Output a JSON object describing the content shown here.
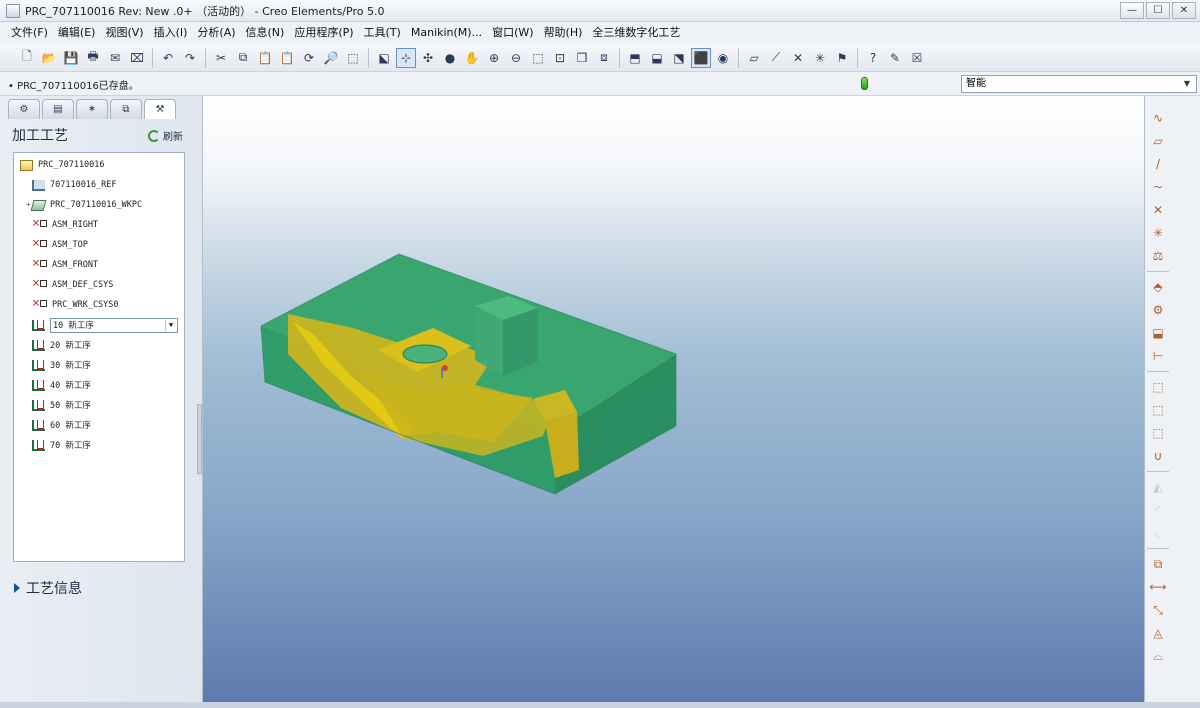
{
  "window": {
    "title": "PRC_707110016 Rev: New .0+  （活动的） - Creo Elements/Pro 5.0",
    "buttons": {
      "minimize": "—",
      "maximize": "☐",
      "close": "✕"
    }
  },
  "menu": [
    "文件(F)",
    "编辑(E)",
    "视图(V)",
    "插入(I)",
    "分析(A)",
    "信息(N)",
    "应用程序(P)",
    "工具(T)",
    "Manikin(M)...",
    "窗口(W)",
    "帮助(H)",
    "全三维数字化工艺"
  ],
  "toolbar": {
    "groups": [
      [
        {
          "icon": "new-file-icon",
          "glyph": "🗋"
        },
        {
          "icon": "open-folder-icon",
          "glyph": "📂"
        },
        {
          "icon": "save-icon",
          "glyph": "💾"
        },
        {
          "icon": "print-icon",
          "glyph": "🖶"
        },
        {
          "icon": "send-mail-icon",
          "glyph": "✉"
        },
        {
          "icon": "close-window-icon",
          "glyph": "⌧"
        }
      ],
      [
        {
          "icon": "undo-icon",
          "glyph": "↶"
        },
        {
          "icon": "redo-icon",
          "glyph": "↷"
        }
      ],
      [
        {
          "icon": "cut-icon",
          "glyph": "✂"
        },
        {
          "icon": "copy-icon",
          "glyph": "⧉"
        },
        {
          "icon": "paste-icon",
          "glyph": "📋"
        },
        {
          "icon": "paste-special-icon",
          "glyph": "📋"
        },
        {
          "icon": "regenerate-icon",
          "glyph": "⟳"
        },
        {
          "icon": "search-icon",
          "glyph": "🔎"
        },
        {
          "icon": "selection-icon",
          "glyph": "⬚"
        }
      ],
      [
        {
          "icon": "repaint-icon",
          "glyph": "⬕"
        },
        {
          "icon": "spin-center-icon",
          "glyph": "⊹",
          "active": true
        },
        {
          "icon": "orient-mode-icon",
          "glyph": "✣"
        },
        {
          "icon": "appearance-icon",
          "glyph": "●"
        },
        {
          "icon": "pan-icon",
          "glyph": "✋"
        },
        {
          "icon": "zoom-in-icon",
          "glyph": "⊕"
        },
        {
          "icon": "zoom-out-icon",
          "glyph": "⊖"
        },
        {
          "icon": "refit-icon",
          "glyph": "⬚"
        },
        {
          "icon": "reorient-icon",
          "glyph": "⊡"
        },
        {
          "icon": "saved-views-icon",
          "glyph": "❒"
        },
        {
          "icon": "layers-icon",
          "glyph": "⧈"
        }
      ],
      [
        {
          "icon": "wireframe-icon",
          "glyph": "⬒"
        },
        {
          "icon": "hidden-line-icon",
          "glyph": "⬓"
        },
        {
          "icon": "no-hidden-icon",
          "glyph": "⬔"
        },
        {
          "icon": "shading-icon",
          "glyph": "⬛",
          "active": true
        },
        {
          "icon": "model-tree-icon",
          "glyph": "◉"
        }
      ],
      [
        {
          "icon": "datum-planes-icon",
          "glyph": "▱"
        },
        {
          "icon": "datum-axes-icon",
          "glyph": "⟋"
        },
        {
          "icon": "datum-points-icon",
          "glyph": "✕"
        },
        {
          "icon": "coord-sys-icon",
          "glyph": "✳"
        },
        {
          "icon": "annotation-icon",
          "glyph": "⚑"
        }
      ],
      [
        {
          "icon": "context-help-icon",
          "glyph": "?"
        },
        {
          "icon": "markup-icon",
          "glyph": "✎"
        },
        {
          "icon": "exit-icon",
          "glyph": "☒"
        }
      ]
    ]
  },
  "message": "• PRC_707110016已存盘。",
  "filter": {
    "value": "智能",
    "arrow": "▼"
  },
  "left_panel": {
    "tabs": [
      {
        "icon": "model-tree-tab-icon",
        "glyph": "⚙"
      },
      {
        "icon": "folder-tab-icon",
        "glyph": "▤"
      },
      {
        "icon": "favorites-tab-icon",
        "glyph": "✶"
      },
      {
        "icon": "layers-tab-icon",
        "glyph": "⧉"
      },
      {
        "icon": "process-tab-icon",
        "glyph": "⚒",
        "active": true
      }
    ],
    "header": "加工工艺",
    "refresh_label": "刷新",
    "tree": [
      {
        "label": "PRC_707110016",
        "icon": "part",
        "indent": 0
      },
      {
        "label": "707110016_REF",
        "icon": "ref",
        "indent": 1
      },
      {
        "label": "PRC_707110016_WKPC",
        "icon": "wk",
        "indent": 1,
        "expand": "+"
      },
      {
        "label": "ASM_RIGHT",
        "icon": "datum",
        "indent": 1
      },
      {
        "label": "ASM_TOP",
        "icon": "datum",
        "indent": 1
      },
      {
        "label": "ASM_FRONT",
        "icon": "datum",
        "indent": 1
      },
      {
        "label": "ASM_DEF_CSYS",
        "icon": "datum",
        "indent": 1
      },
      {
        "label": "PRC_WRK_CSYS0",
        "icon": "datum",
        "indent": 1
      },
      {
        "label": "10 新工序",
        "icon": "op",
        "indent": 1,
        "editing": true
      },
      {
        "label": "20 新工序",
        "icon": "op",
        "indent": 1
      },
      {
        "label": "30 新工序",
        "icon": "op",
        "indent": 1
      },
      {
        "label": "40 新工序",
        "icon": "op",
        "indent": 1
      },
      {
        "label": "50 新工序",
        "icon": "op",
        "indent": 1
      },
      {
        "label": "60 新工序",
        "icon": "op",
        "indent": 1
      },
      {
        "label": "70 新工序",
        "icon": "op",
        "indent": 1
      }
    ],
    "section": "工艺信息"
  },
  "right_toolbar": [
    {
      "icon": "sketch-tool-icon",
      "glyph": "∿"
    },
    {
      "icon": "plane-tool-icon",
      "glyph": "▱"
    },
    {
      "icon": "axis-tool-icon",
      "glyph": "/"
    },
    {
      "icon": "curve-tool-icon",
      "glyph": "~"
    },
    {
      "icon": "point-tool-icon",
      "glyph": "✕"
    },
    {
      "icon": "csys-tool-icon",
      "glyph": "✳"
    },
    {
      "icon": "analysis-feature-icon",
      "glyph": "⚖"
    },
    {
      "icon": "workcell-icon",
      "glyph": "⬘"
    },
    {
      "icon": "operation-icon",
      "glyph": "⚙"
    },
    {
      "icon": "mill-volume-icon",
      "glyph": "⬓"
    },
    {
      "icon": "dimension-icon",
      "glyph": "⊢"
    },
    {
      "icon": "nc-sequence-icon",
      "glyph": "⬚"
    },
    {
      "icon": "nc-sequence-2-icon",
      "glyph": "⬚"
    },
    {
      "icon": "nc-sequence-3-icon",
      "glyph": "⬚"
    },
    {
      "icon": "profile-icon",
      "glyph": "∪"
    },
    {
      "icon": "sweep-icon",
      "glyph": "◭",
      "dim": true
    },
    {
      "icon": "round-icon",
      "glyph": "◜",
      "dim": true
    },
    {
      "icon": "chamfer-icon",
      "glyph": "◟",
      "dim": true
    },
    {
      "icon": "copy-geom-icon",
      "glyph": "⧉"
    },
    {
      "icon": "mirror-icon",
      "glyph": "⟷"
    },
    {
      "icon": "extend-icon",
      "glyph": "⤡"
    },
    {
      "icon": "surface-icon",
      "glyph": "◬"
    },
    {
      "icon": "offset-icon",
      "glyph": "⌓"
    }
  ],
  "colors": {
    "part_green": "#3fb07a",
    "part_yellow": "#d8c21a",
    "accent": "#1d4f8a"
  }
}
